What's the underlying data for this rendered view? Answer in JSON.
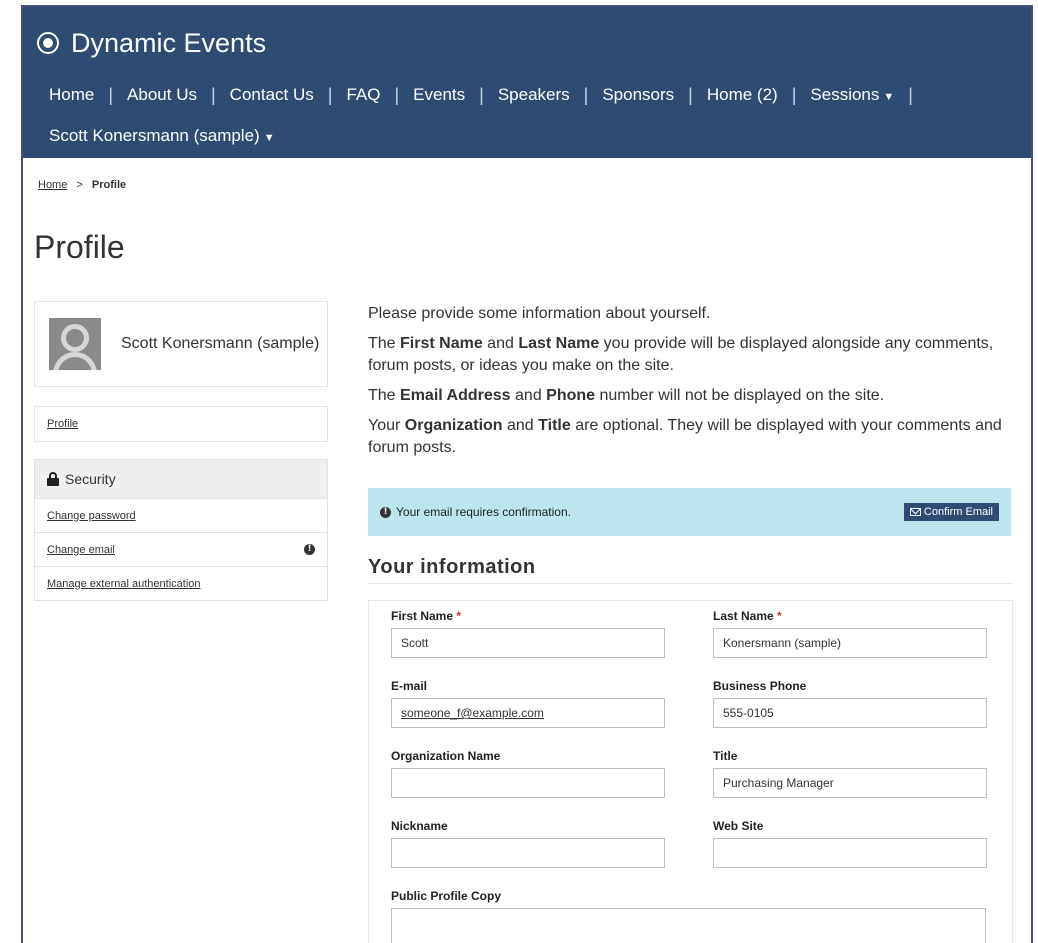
{
  "header": {
    "brand": "Dynamic Events",
    "nav_row1": [
      "Home",
      "About Us",
      "Contact Us",
      "FAQ",
      "Events",
      "Speakers",
      "Sponsors",
      "Home (2)",
      "Sessions"
    ],
    "nav_row2_user": "Scott Konersmann (sample)",
    "brand_color": "#2f4b73"
  },
  "breadcrumb": {
    "home": "Home",
    "separator": ">",
    "current": "Profile"
  },
  "page_title": "Profile",
  "sidebar": {
    "user_name": "Scott Konersmann (sample)",
    "profile_link": "Profile",
    "security_heading": "Security",
    "security_items": [
      "Change password",
      "Change email",
      "Manage external authentication"
    ]
  },
  "intro": {
    "p1": "Please provide some information about yourself.",
    "p2_a": "The ",
    "p2_b": "First Name",
    "p2_c": " and ",
    "p2_d": "Last Name",
    "p2_e": " you provide will be displayed alongside any comments, forum posts, or ideas you make on the site.",
    "p3_a": "The ",
    "p3_b": "Email Address",
    "p3_c": " and ",
    "p3_d": "Phone",
    "p3_e": " number will not be displayed on the site.",
    "p4_a": "Your ",
    "p4_b": "Organization",
    "p4_c": " and ",
    "p4_d": "Title",
    "p4_e": " are optional. They will be displayed with your comments and forum posts."
  },
  "alert": {
    "text": "Your email requires confirmation.",
    "button": "Confirm Email",
    "background": "#bde5ee"
  },
  "form": {
    "section_title": "Your information",
    "required_mark": "*",
    "first_name": {
      "label": "First Name",
      "value": "Scott"
    },
    "last_name": {
      "label": "Last Name",
      "value": "Konersmann (sample)"
    },
    "email": {
      "label": "E-mail",
      "value": "someone_f@example.com"
    },
    "business_phone": {
      "label": "Business Phone",
      "value": "555-0105"
    },
    "organization": {
      "label": "Organization Name",
      "value": ""
    },
    "title": {
      "label": "Title",
      "value": "Purchasing Manager"
    },
    "nickname": {
      "label": "Nickname",
      "value": ""
    },
    "website": {
      "label": "Web Site",
      "value": ""
    },
    "public_profile": {
      "label": "Public Profile Copy",
      "value": ""
    }
  }
}
